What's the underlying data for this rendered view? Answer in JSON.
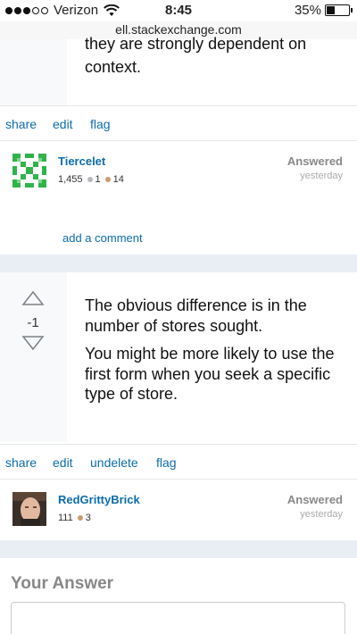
{
  "status_bar": {
    "carrier": "Verizon",
    "time": "8:45",
    "battery": "35%"
  },
  "url_bar": {
    "url": "ell.stackexchange.com"
  },
  "answer1": {
    "text_tail_cut": "they are strongly dependent on",
    "text_tail": "context.",
    "actions": {
      "share": "share",
      "edit": "edit",
      "flag": "flag"
    },
    "user": {
      "name": "Tiercelet",
      "reputation": "1,455",
      "silver": "1",
      "bronze": "14",
      "status": "Answered",
      "when": "yesterday"
    },
    "add_comment": "add a comment"
  },
  "answer2": {
    "score": "-1",
    "paragraphs": [
      "The obvious difference is in the number of stores sought.",
      "You might be more likely to use the first form when you seek a specific type of store."
    ],
    "actions": {
      "share": "share",
      "edit": "edit",
      "undelete": "undelete",
      "flag": "flag"
    },
    "user": {
      "name": "RedGrittyBrick",
      "reputation": "111",
      "bronze": "3",
      "status": "Answered",
      "when": "yesterday"
    }
  },
  "your_answer": {
    "heading": "Your Answer"
  },
  "colors": {
    "link": "#0c6cad",
    "separator": "#e9eef4"
  }
}
